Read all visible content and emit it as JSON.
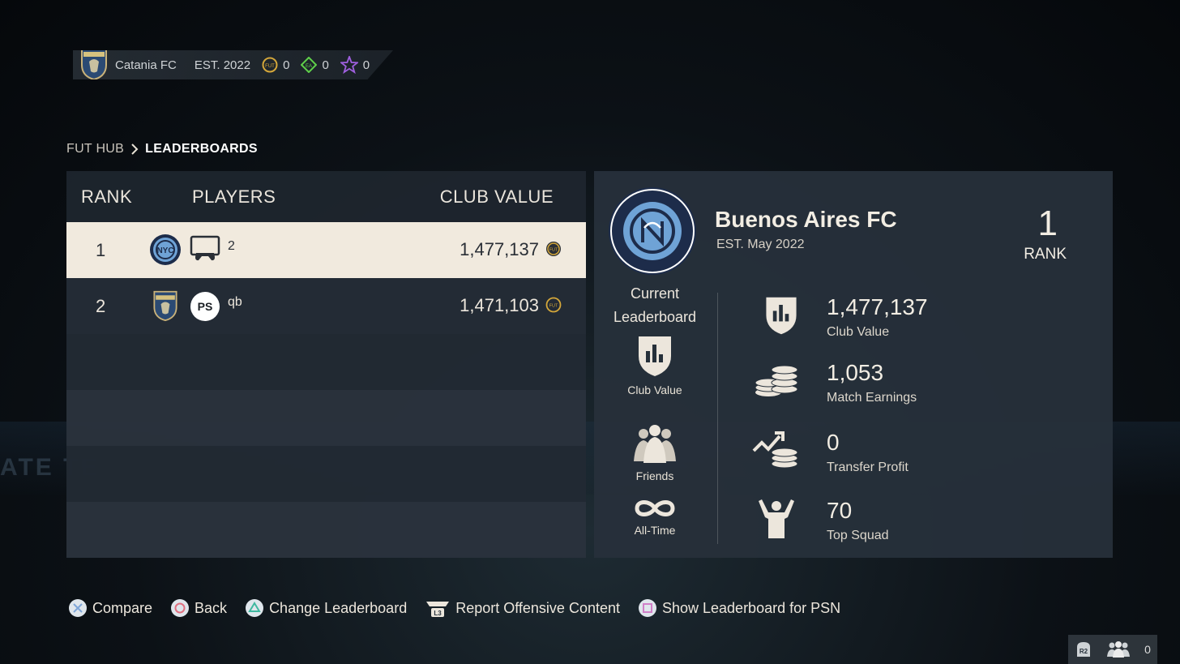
{
  "topbar": {
    "club_name": "Catania FC",
    "est": "EST. 2022",
    "currencies": [
      {
        "icon": "fut-coin-icon",
        "value": "0",
        "color": "#d4a73a"
      },
      {
        "icon": "ea-points-icon",
        "value": "0",
        "color": "#5fd04a"
      },
      {
        "icon": "fut-points-star-icon",
        "value": "0",
        "color": "#a060e0"
      }
    ]
  },
  "breadcrumb": {
    "home": "FUT HUB",
    "current": "LEADERBOARDS"
  },
  "table": {
    "headers": {
      "rank": "RANK",
      "players": "PLAYERS",
      "value": "CLUB VALUE"
    },
    "rows": [
      {
        "rank": "1",
        "crest": "nycfc-crest-icon",
        "platform": "controller-icon",
        "player": "2",
        "club_value": "1,477,137"
      },
      {
        "rank": "2",
        "crest": "catania-crest-icon",
        "platform": "playstation-icon",
        "player": "qb",
        "club_value": "1,471,103"
      }
    ]
  },
  "panel": {
    "club_name": "Buenos Aires FC",
    "est": "EST. May 2022",
    "rank": "1",
    "rank_label": "RANK",
    "current_leaderboard_label": "Current Leaderboard",
    "filters": [
      {
        "icon": "club-value-shield-icon",
        "label": "Club Value"
      },
      {
        "icon": "friends-icon",
        "label": "Friends"
      },
      {
        "icon": "infinity-icon",
        "label": "All-Time"
      }
    ],
    "stats": [
      {
        "icon": "club-value-shield-icon",
        "value": "1,477,137",
        "label": "Club Value"
      },
      {
        "icon": "coins-stack-icon",
        "value": "1,053",
        "label": "Match Earnings"
      },
      {
        "icon": "transfer-profit-icon",
        "value": "0",
        "label": "Transfer Profit"
      },
      {
        "icon": "top-squad-player-icon",
        "value": "70",
        "label": "Top Squad"
      }
    ]
  },
  "footer": {
    "buttons": [
      {
        "icon": "cross-button-icon",
        "label": "Compare"
      },
      {
        "icon": "circle-button-icon",
        "label": "Back"
      },
      {
        "icon": "triangle-button-icon",
        "label": "Change Leaderboard"
      },
      {
        "icon": "l3-button-icon",
        "label": "Report Offensive Content"
      },
      {
        "icon": "square-button-icon",
        "label": "Show Leaderboard for PSN"
      }
    ],
    "corner_button": "R2",
    "online_friends": "0"
  }
}
